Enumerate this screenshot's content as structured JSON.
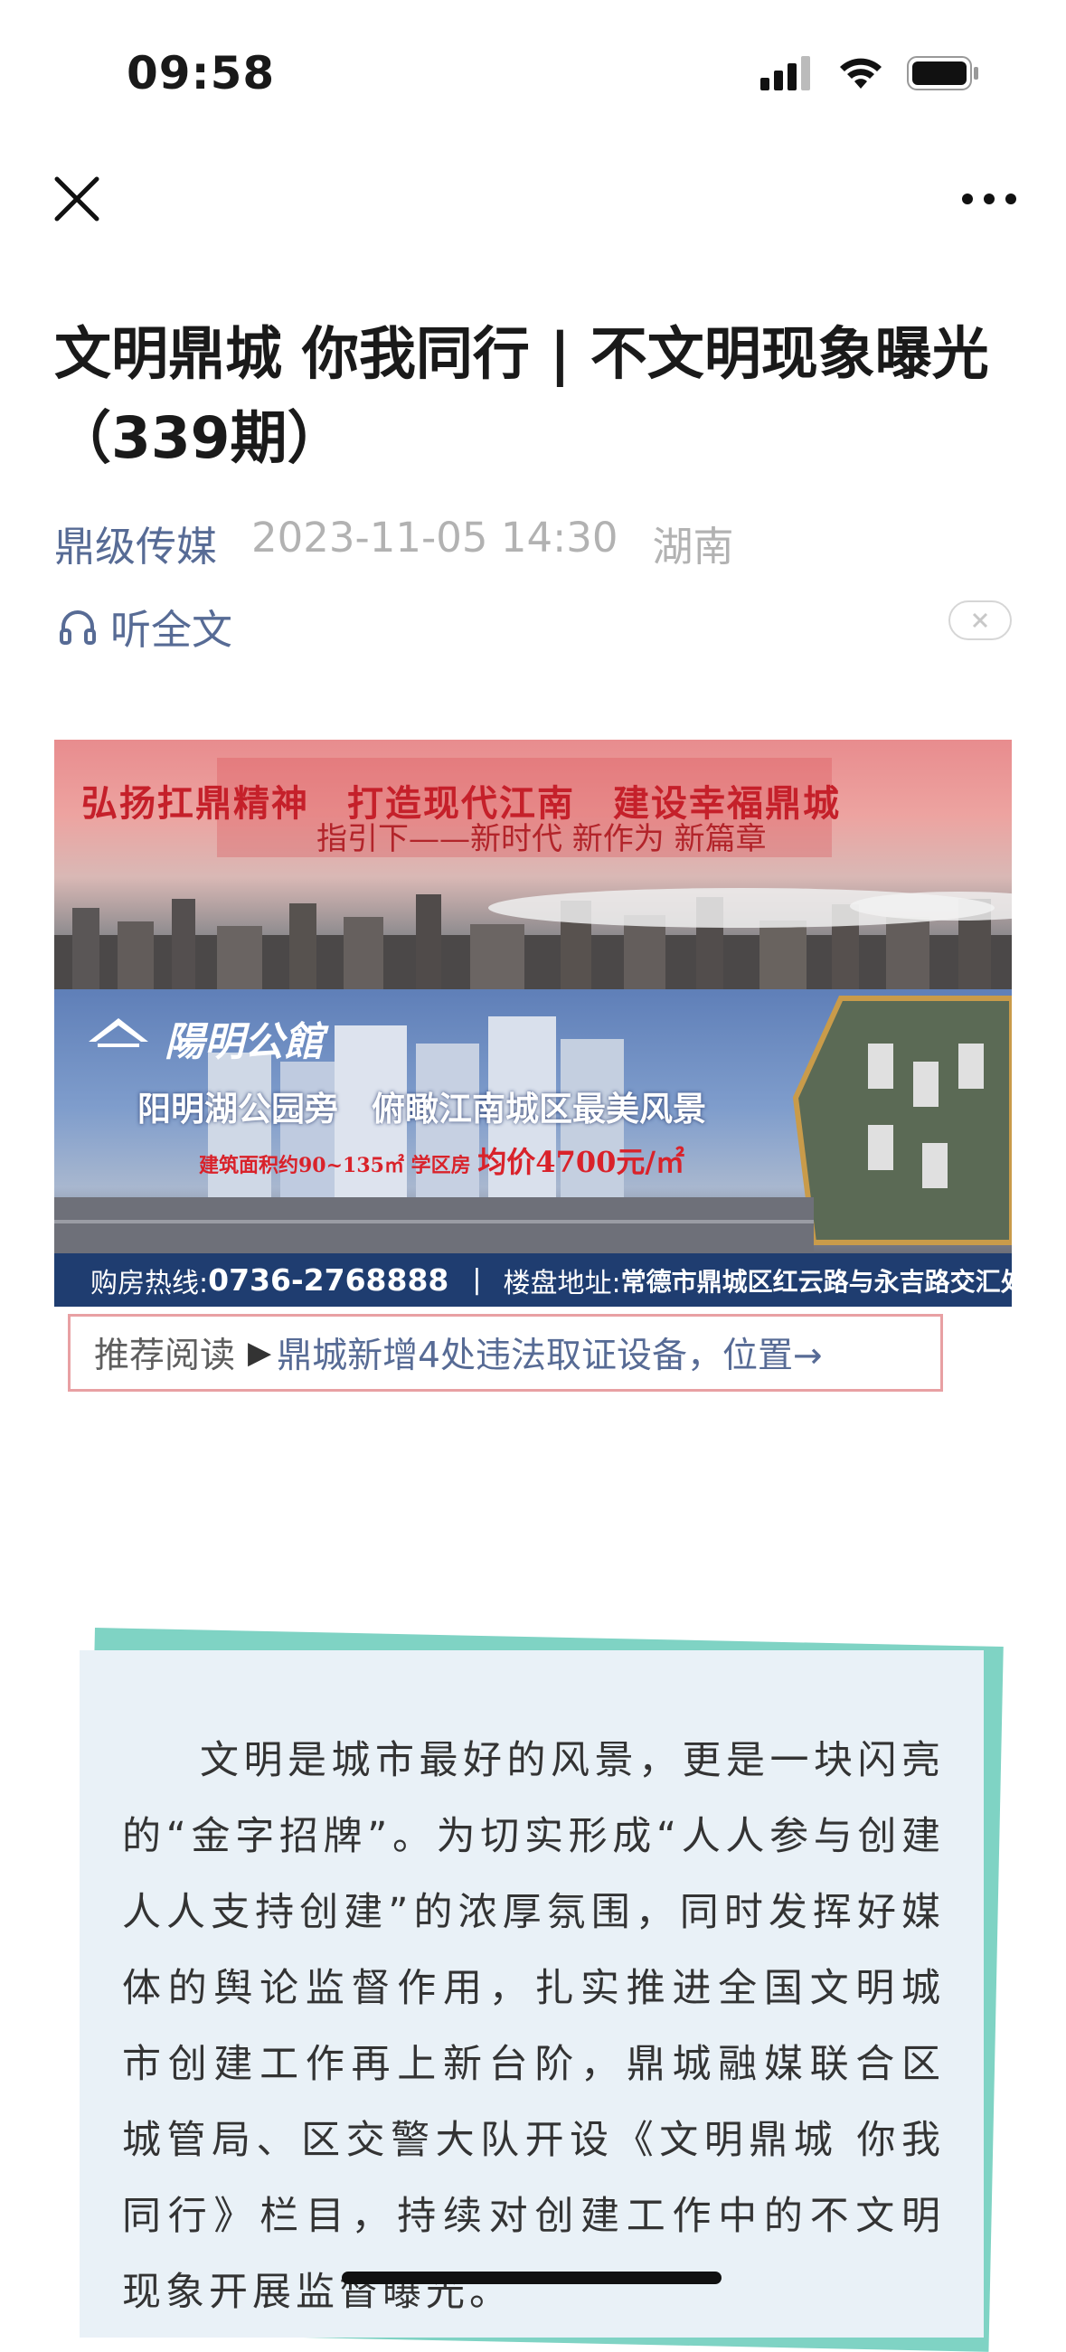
{
  "status_bar": {
    "time": "09:58"
  },
  "article": {
    "title": "文明鼎城 你我同行 | 不文明现象曝光（339期）",
    "author": "鼎级传媒",
    "date": "2023-11-05 14:30",
    "region": "湖南",
    "listen_label": "听全文"
  },
  "banner": {
    "slogan": "弘扬扛鼎精神　打造现代江南　建设幸福鼎城",
    "slogan_sub": "指引下——新时代 新作为 新篇章",
    "project_name": "陽明公館",
    "headline": "阳明湖公园旁　俯瞰江南城区最美风景",
    "price_prefix": "建筑面积约90~135㎡ 学区房 ",
    "price": "均价4700元/㎡",
    "hotline_label": "购房热线:",
    "hotline": "0736-2768888",
    "address_label": "楼盘地址:",
    "address": "常德市鼎城区红云路与永吉路交汇处"
  },
  "recommend": {
    "label": "推荐阅读",
    "link": "鼎城新增4处违法取证设备，位置→"
  },
  "body": {
    "paragraph": "文明是城市最好的风景，更是一块闪亮的“金字招牌”。为切实形成“人人参与创建 人人支持创建”的浓厚氛围，同时发挥好媒体的舆论监督作用，扎实推进全国文明城市创建工作再上新台阶，鼎城融媒联合区城管局、区交警大队开设《文明鼎城 你我同行》栏目，持续对创建工作中的不文明现象开展监督曝光。"
  },
  "icons": {
    "close": "close-icon",
    "more": "more-icon",
    "headphones": "headphones-icon",
    "signal": "signal-icon",
    "wifi": "wifi-icon",
    "battery": "battery-icon"
  },
  "colors": {
    "link_blue": "#576b95",
    "meta_gray": "#b2b2b2",
    "card_bg": "#e9f1f7",
    "card_accent": "#7fd3c4"
  }
}
